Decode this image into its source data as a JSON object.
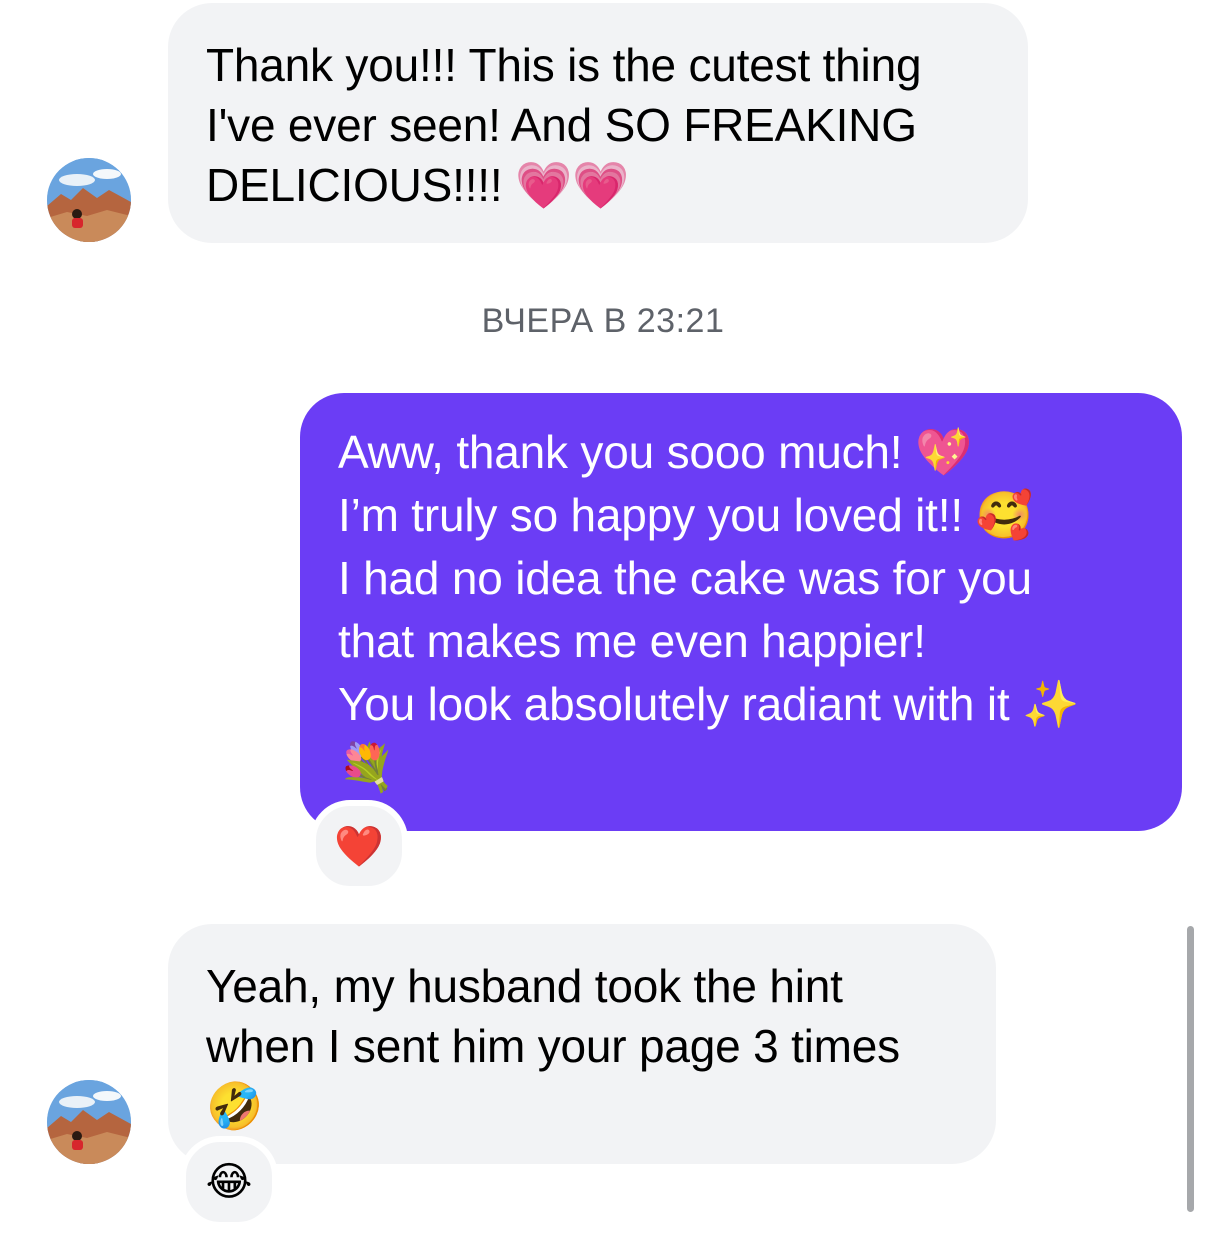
{
  "conversation": {
    "messages": [
      {
        "direction": "incoming",
        "lines": [
          "Thank you!!! This is the cutest thing",
          "I've ever seen! And SO FREAKING",
          "DELICIOUS!!!! 💗💗"
        ]
      },
      {
        "direction": "outgoing",
        "lines": [
          "Aww, thank you sooo much! 💖",
          "I’m truly so happy you loved it!! 🥰",
          "I had no idea the cake was for you",
          "that makes me even happier!",
          "You look absolutely radiant with it ✨",
          "💐"
        ],
        "reaction": "❤️"
      },
      {
        "direction": "incoming",
        "lines": [
          "Yeah, my husband took the hint",
          "when I sent him your page 3 times",
          "🤣"
        ],
        "reaction": "😂"
      }
    ],
    "timestamp": "ВЧЕРА В 23:21"
  },
  "colors": {
    "outgoing_bubble": "#6b3df5",
    "incoming_bubble": "#f2f3f5",
    "timestamp_text": "#5e6269"
  }
}
